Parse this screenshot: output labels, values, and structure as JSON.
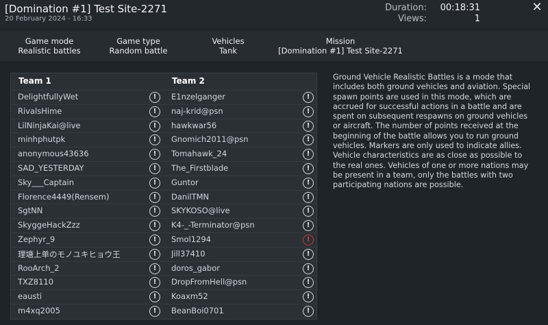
{
  "header": {
    "title": "[Domination #1] Test Site-2271",
    "date": "20 February 2024 - 16:33",
    "duration_label": "Duration:",
    "duration_value": "00:18:31",
    "views_label": "Views:",
    "views_value": "1",
    "close_glyph": "✕"
  },
  "info": [
    {
      "label": "Game mode",
      "value": "Realistic battles"
    },
    {
      "label": "Game type",
      "value": "Random battle"
    },
    {
      "label": "Vehicles",
      "value": "Tank"
    },
    {
      "label": "Mission",
      "value": "[Domination #1] Test Site-2271"
    }
  ],
  "team1": {
    "title": "Team 1",
    "players": [
      "DelightfullyWet",
      "RivalsHime",
      "LilNinjaKai@live",
      "minhphutpk",
      "anonymous43636",
      "SAD_YESTERDAY",
      "Sky___Captain",
      "Florence4449(Rensem)",
      "SgtNN",
      "SkyggeHackZzz",
      "Zephyr_9",
      "理塘上单のモノユキヒョウ王",
      "RooArch_2",
      "TXZ8110",
      "eausti",
      "m4xq2005"
    ]
  },
  "team2": {
    "title": "Team 2",
    "players": [
      "E1nzelganger",
      "naj-krid@psn",
      "hawkwar56",
      "Gnomich2011@psn",
      "Tomahawk_24",
      "The_Firstblade",
      "Guntor",
      "DanilTMN",
      "SKYKOSO@live",
      "K4-_-Terminator@psn",
      "Smol1294",
      "Jill37410",
      "doros_gabor",
      "DropFromHell@psn",
      "Koaxm52",
      "BeanBoi0701"
    ],
    "flagged_index": 10
  },
  "alert_glyph": "!",
  "description": "Ground Vehicle Realistic Battles is a mode that includes both ground vehicles and aviation. Special spawn points are used in this mode, which are accrued for successful actions in a battle and are spent on subsequent respawns on ground vehicles or aircraft. The number of points received at the beginning of the battle allows you to run ground vehicles. Markers are only used to indicate allies. Vehicle characteristics are as close as possible to the real ones. Vehicles of one or more nations may be present in a team, only the battles with two participating nations are possible."
}
